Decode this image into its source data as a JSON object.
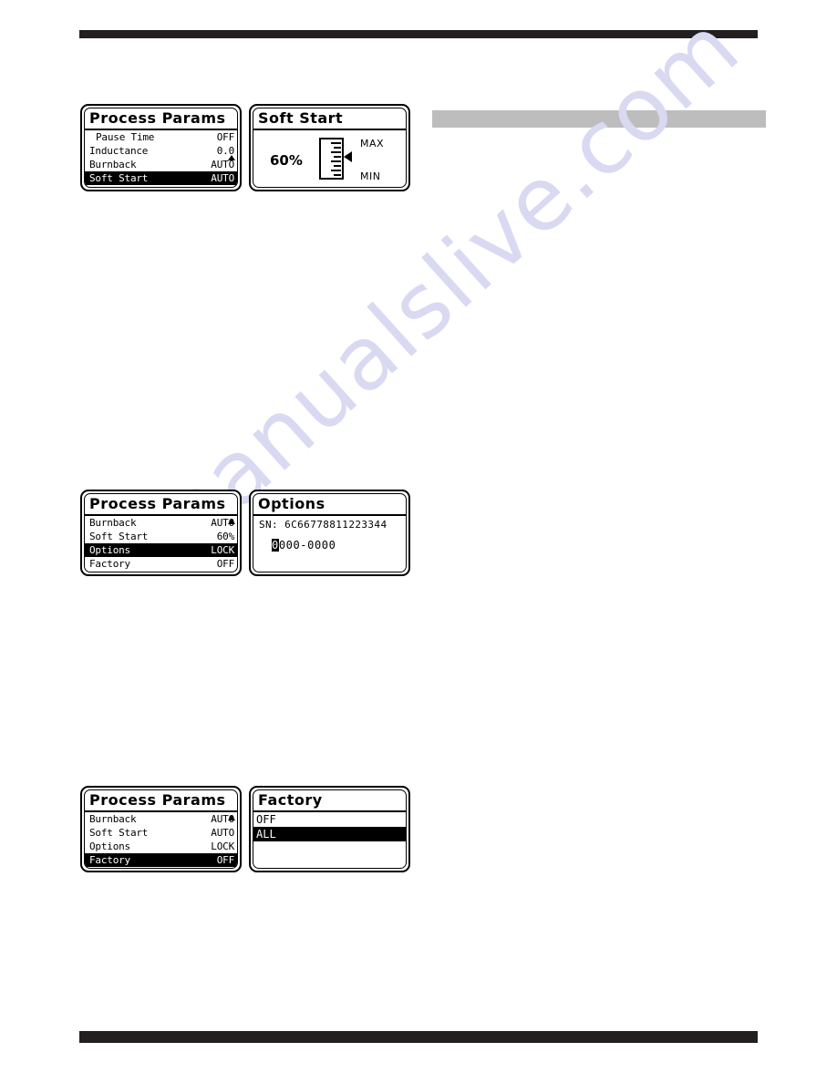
{
  "page": {
    "watermark_text": "manualslive.com"
  },
  "grey_block": {
    "label": ""
  },
  "panels": [
    {
      "id": "process-params-1",
      "title": "Process Params",
      "scroll_up": "▲",
      "scroll_down": "▼",
      "rows": [
        {
          "label": "Pause Time",
          "value": "OFF",
          "selected": false,
          "indent": true
        },
        {
          "label": "Inductance",
          "value": "0.0",
          "selected": false,
          "indent": false
        },
        {
          "label": "Burnback",
          "value": "AUTO",
          "selected": false,
          "indent": false
        },
        {
          "label": "Soft Start",
          "value": "AUTO",
          "selected": true,
          "indent": false
        }
      ]
    },
    {
      "id": "soft-start",
      "title": "Soft Start",
      "percent": "60%",
      "max_label": "MAX",
      "min_label": "MIN",
      "tick_count": 9,
      "pointer_position_pct": 40
    },
    {
      "id": "process-params-2",
      "title": "Process Params",
      "scroll_up": "▲",
      "rows": [
        {
          "label": "Burnback",
          "value": "AUTO",
          "selected": false,
          "indent": false
        },
        {
          "label": "Soft Start",
          "value": "60%",
          "selected": false,
          "indent": false
        },
        {
          "label": "Options",
          "value": "LOCK",
          "selected": true,
          "indent": false
        },
        {
          "label": "Factory",
          "value": "OFF",
          "selected": false,
          "indent": false
        }
      ]
    },
    {
      "id": "options",
      "title": "Options",
      "sn_label": "SN:",
      "sn_value": "6C66778811223344",
      "code_cursor_char": "0",
      "code_rest": "000-0000"
    },
    {
      "id": "process-params-3",
      "title": "Process Params",
      "scroll_up": "▲",
      "rows": [
        {
          "label": "Burnback",
          "value": "AUTO",
          "selected": false,
          "indent": false
        },
        {
          "label": "Soft Start",
          "value": "AUTO",
          "selected": false,
          "indent": false
        },
        {
          "label": "Options",
          "value": "LOCK",
          "selected": false,
          "indent": false
        },
        {
          "label": "Factory",
          "value": "OFF",
          "selected": true,
          "indent": false
        }
      ]
    },
    {
      "id": "factory",
      "title": "Factory",
      "options": [
        {
          "label": "OFF",
          "highlighted": false
        },
        {
          "label": "ALL",
          "highlighted": true
        }
      ]
    }
  ]
}
